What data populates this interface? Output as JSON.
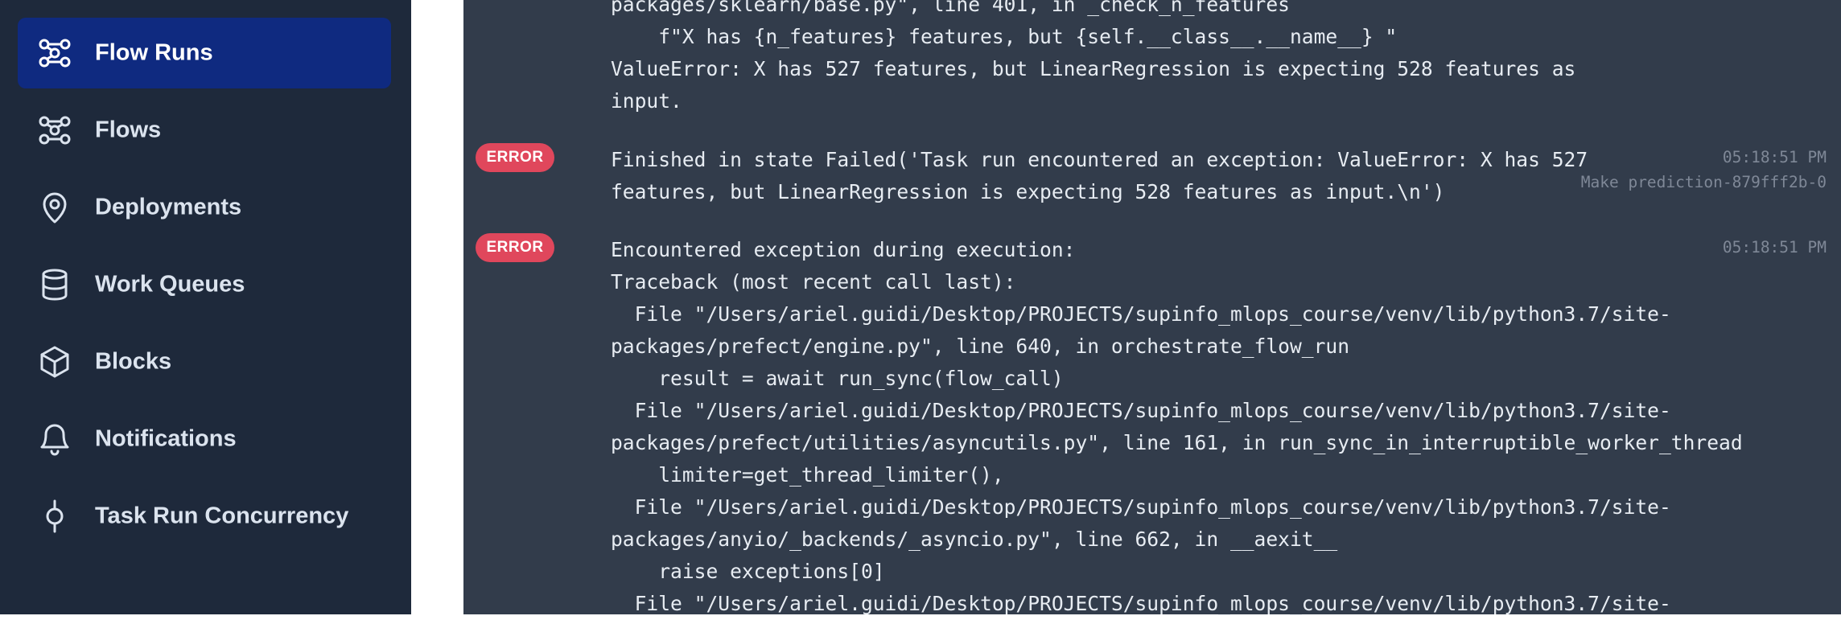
{
  "sidebar": {
    "items": [
      {
        "label": "Flow Runs",
        "icon": "flow-runs-icon",
        "active": true
      },
      {
        "label": "Flows",
        "icon": "flows-icon"
      },
      {
        "label": "Deployments",
        "icon": "map-pin-icon"
      },
      {
        "label": "Work Queues",
        "icon": "database-icon"
      },
      {
        "label": "Blocks",
        "icon": "cube-icon"
      },
      {
        "label": "Notifications",
        "icon": "bell-icon"
      },
      {
        "label": "Task Run Concurrency",
        "icon": "concurrency-icon"
      }
    ]
  },
  "logs": {
    "continuation": "packages/sklearn/base.py\", line 401, in _check_n_features\n    f\"X has {n_features} features, but {self.__class__.__name__} \"\nValueError: X has 527 features, but LinearRegression is expecting 528 features as\ninput.",
    "entries": [
      {
        "level": "ERROR",
        "message": "Finished in state Failed('Task run encountered an exception: ValueError: X has 527\nfeatures, but LinearRegression is expecting 528 features as input.\\n')",
        "time": "05:18:51 PM",
        "task": "Make prediction-879fff2b-0"
      },
      {
        "level": "ERROR",
        "message": "Encountered exception during execution:\nTraceback (most recent call last):\n  File \"/Users/ariel.guidi/Desktop/PROJECTS/supinfo_mlops_course/venv/lib/python3.7/site-\npackages/prefect/engine.py\", line 640, in orchestrate_flow_run\n    result = await run_sync(flow_call)\n  File \"/Users/ariel.guidi/Desktop/PROJECTS/supinfo_mlops_course/venv/lib/python3.7/site-\npackages/prefect/utilities/asyncutils.py\", line 161, in run_sync_in_interruptible_worker_thread\n    limiter=get_thread_limiter(),\n  File \"/Users/ariel.guidi/Desktop/PROJECTS/supinfo_mlops_course/venv/lib/python3.7/site-\npackages/anyio/_backends/_asyncio.py\", line 662, in __aexit__\n    raise exceptions[0]\n  File \"/Users/ariel.guidi/Desktop/PROJECTS/supinfo_mlops_course/venv/lib/python3.7/site-",
        "time": "05:18:51 PM"
      }
    ]
  },
  "colors": {
    "sidebar_bg": "#1e293b",
    "active_bg": "#0f2a80",
    "log_bg": "#323c4b",
    "error_badge": "#e0475c"
  }
}
